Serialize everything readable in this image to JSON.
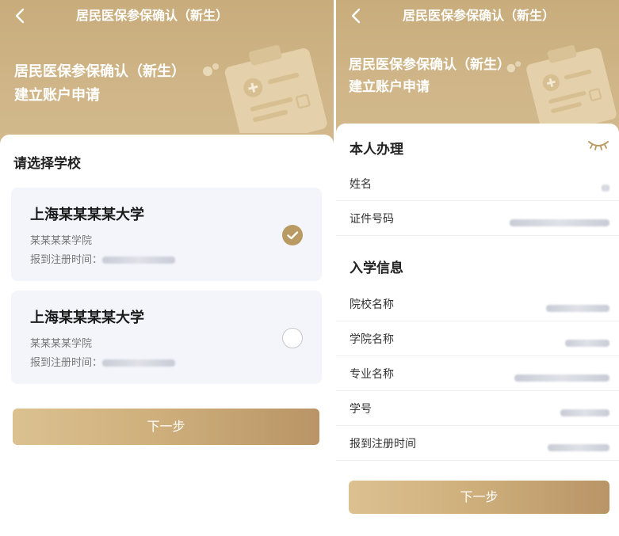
{
  "left": {
    "nav": {
      "back_icon": "chevron-left-icon",
      "title": "居民医保参保确认（新生）"
    },
    "hero": {
      "title_line1": "居民医保参保确认（新生）",
      "title_line2": "建立账户申请"
    },
    "section_title": "请选择学校",
    "schools": [
      {
        "name": "上海某某某某大学",
        "college": "某某某某学院",
        "reg_label": "报到注册时间：",
        "selected": true
      },
      {
        "name": "上海某某某某大学",
        "college": "某某某某学院",
        "reg_label": "报到注册时间：",
        "selected": false
      }
    ],
    "next_label": "下一步"
  },
  "right": {
    "nav": {
      "back_icon": "chevron-left-icon",
      "title": "居民医保参保确认（新生）"
    },
    "hero": {
      "title_line1": "居民医保参保确认（新生）",
      "title_line2": "建立账户申请"
    },
    "personal": {
      "title": "本人办理",
      "eye_icon": "eye-closed-icon",
      "fields": [
        {
          "label": "姓名"
        },
        {
          "label": "证件号码"
        }
      ]
    },
    "enrollment": {
      "title": "入学信息",
      "fields": [
        {
          "label": "院校名称"
        },
        {
          "label": "学院名称"
        },
        {
          "label": "专业名称"
        },
        {
          "label": "学号"
        },
        {
          "label": "报到注册时间"
        }
      ]
    },
    "next_label": "下一步"
  },
  "colors": {
    "hero": "#cdb383",
    "accent": "#b89a62",
    "button_start": "#dcc190",
    "button_end": "#b99466",
    "card_bg": "#f3f5fb"
  }
}
